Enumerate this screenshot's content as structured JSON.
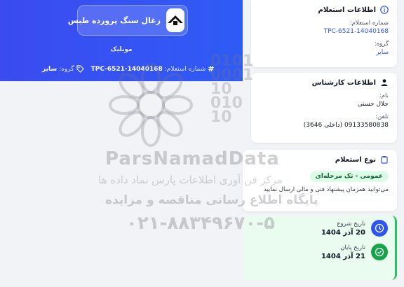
{
  "banner": {
    "company_name": "زغال سنگ پرورده طبس",
    "subtitle": "موبلیک",
    "inquiry_label": "شماره استعلام:",
    "inquiry_number": "TPC-6521-14040168",
    "group_label": "گروه:",
    "group_value": "سایر"
  },
  "inquiry_info": {
    "title": "اطلاعات استعلام",
    "number_label": "شماره استعلام:",
    "number_value": "TPC-6521-14040168",
    "group_label": "گروه:",
    "group_value": "سایر"
  },
  "expert_info": {
    "title": "اطلاعات کارشناس",
    "name_label": "نام:",
    "name_value": "جلال حسنی",
    "phone_label": "تلفن:",
    "phone_value": "09133580838 (داخلی 3646)"
  },
  "inquiry_type": {
    "title": "نوع استعلام",
    "badge": "عمومی - تک مرحله‌ای",
    "description": "می‌توانید همزمان پیشنهاد فنی و مالی ارسال نمایید"
  },
  "dates": {
    "start_label": "تاریخ شروع",
    "start_value": "20 آذر 1404",
    "end_label": "تاریخ پایان",
    "end_value": "21 آذر 1404"
  },
  "watermark": {
    "brand": "ParsNamadData",
    "line1": "مرکز فن آوری اطلاعات پارس نماد داده ها",
    "line2": "پایگاه اطلاع رسانی مناقصه و مزایده",
    "phone": "۰۲۱-۸۸۳۴۹۶۷۰-۵",
    "binary": "0101\n0001\n10\n010\n10"
  },
  "colors": {
    "banner": "#2f55f0",
    "accent": "#2f55f0",
    "success": "#22c55e"
  }
}
